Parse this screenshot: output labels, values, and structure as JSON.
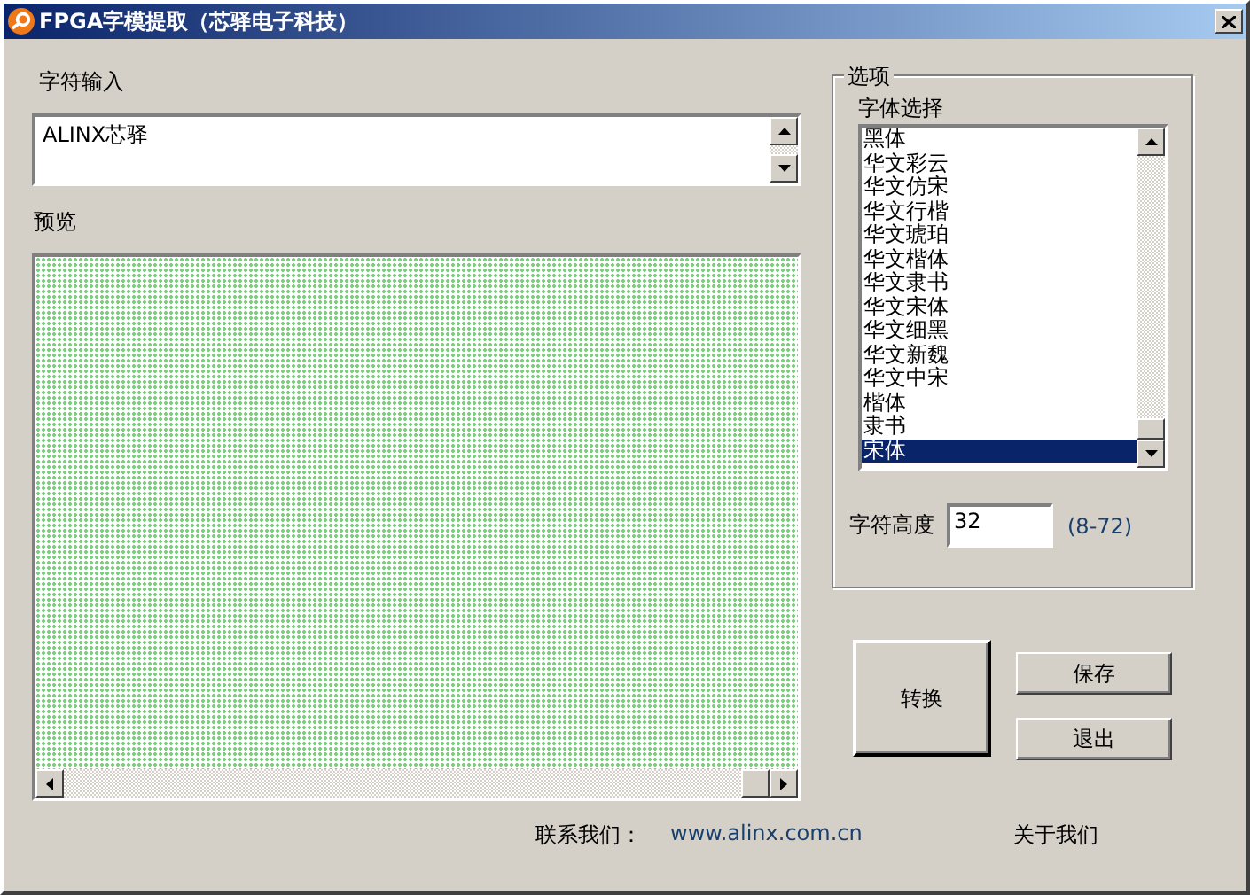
{
  "window": {
    "title": "FPGA字模提取（芯驿电子科技）"
  },
  "input": {
    "label": "字符输入",
    "value": "ALINX芯驿"
  },
  "preview": {
    "label": "预览"
  },
  "options": {
    "title": "选项",
    "font_label": "字体选择",
    "fonts": [
      {
        "label": "黑体",
        "selected": false
      },
      {
        "label": "华文彩云",
        "selected": false
      },
      {
        "label": "华文仿宋",
        "selected": false
      },
      {
        "label": "华文行楷",
        "selected": false
      },
      {
        "label": "华文琥珀",
        "selected": false
      },
      {
        "label": "华文楷体",
        "selected": false
      },
      {
        "label": "华文隶书",
        "selected": false
      },
      {
        "label": "华文宋体",
        "selected": false
      },
      {
        "label": "华文细黑",
        "selected": false
      },
      {
        "label": "华文新魏",
        "selected": false
      },
      {
        "label": "华文中宋",
        "selected": false
      },
      {
        "label": "楷体",
        "selected": false
      },
      {
        "label": "隶书",
        "selected": false
      },
      {
        "label": "宋体",
        "selected": true
      }
    ],
    "height_label": "字符高度",
    "height_value": "32",
    "height_range": "(8-72)"
  },
  "buttons": [
    {
      "label": "转换",
      "kind": "large"
    },
    {
      "label": "保存",
      "kind": "small"
    },
    {
      "label": "退出",
      "kind": "small"
    }
  ],
  "footer": {
    "contact_label": "联系我们：",
    "link": "www.alinx.com.cn",
    "about": "关于我们"
  }
}
